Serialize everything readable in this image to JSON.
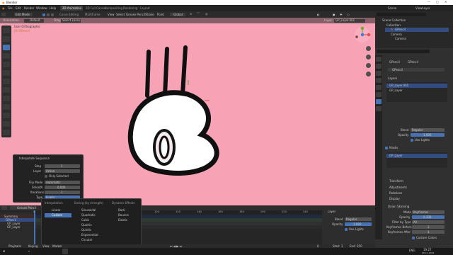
{
  "app": {
    "title": "Blender"
  },
  "menu": {
    "items": [
      "File",
      "Edit",
      "Render",
      "Window",
      "Help"
    ],
    "workspaces": [
      "2D Animation",
      "2D Full Canvas",
      "Compositing",
      "Rendering",
      "Layout"
    ],
    "scene_label": "Scene",
    "view_layer_label": "ViewLayer"
  },
  "header3d": {
    "mode": "Edit Mode",
    "view": "View",
    "select": "Select",
    "gpencil": "Grease Pencil",
    "stroke": "Stroke",
    "point": "Point",
    "orientation": "Global",
    "orient_label": "Orientation:",
    "orient_value": "Default",
    "drag_label": "Drag:",
    "drag_value": "Select Lasso",
    "curve_editing": "Curve Editing",
    "multiframe": "Multiframe",
    "layer_label": "Layer",
    "layer_value": "GP_Layer.001"
  },
  "viewport": {
    "info_line1": "User Orthographic",
    "info_line2": "(0) GPencil",
    "accent": "#f8a2b5"
  },
  "outliner": {
    "title": "Scene Collection",
    "items": [
      "Collection",
      "GPencil",
      "Camera",
      "Camera"
    ]
  },
  "props": {
    "object": "GPencil",
    "data": "GPencil",
    "datablock": "GPencil",
    "layers_header": "Layers",
    "layers": [
      "GP_Layer.001",
      "GP_Layer"
    ],
    "blend_label": "Blend",
    "blend_value": "Regular",
    "opacity_label": "Opacity",
    "opacity_value": "1.000",
    "use_lights": "Use Lights",
    "masks_header": "Masks",
    "mask_item": "GP_Layer",
    "sections": [
      "Transform",
      "Adjustments",
      "Relations",
      "Display"
    ],
    "onion_header": "Onion Skinning",
    "mode_label": "Mode",
    "mode_value": "Keyframes",
    "onion_opacity_label": "Opacity",
    "onion_opacity_value": "0.330",
    "filter_label": "Filter by Type",
    "filter_value": "All",
    "keys_before_label": "Keyframes Before",
    "keys_before_value": "1",
    "keys_after_label": "Keyframes After",
    "keys_after_value": "1",
    "custom_colors": "Custom Colors"
  },
  "lastop": {
    "title": "Interpolate Sequence",
    "step_label": "Step",
    "step_value": "1",
    "layer_label": "Layer",
    "layer_value": "Active",
    "only_selected": "Only Selected",
    "flip_label": "Flip Mode",
    "flip_value": "Automatic",
    "smooth_label": "Smooth",
    "smooth_value": "0.000",
    "iter_label": "Iterations",
    "iter_value": "1",
    "type_label": "Type",
    "type_value": "Linear"
  },
  "interp": {
    "col1_header": "Interpolation",
    "col2_header": "Easing (by strength)",
    "col3_header": "Dynamic Effects",
    "col1": [
      "Linear",
      "Custom"
    ],
    "col2": [
      "Sinusoidal",
      "Quadratic",
      "Cubic",
      "Quartic",
      "Quintic",
      "Exponential",
      "Circular"
    ],
    "col3": [
      "Back",
      "Bounce",
      "Elastic"
    ]
  },
  "timeline": {
    "mode": "Grease Pencil",
    "summary": "Summary",
    "object": "GPencil",
    "layers": [
      "GP_Layer",
      "GP_Layer"
    ],
    "ticks": [
      "0",
      "20",
      "40",
      "60",
      "80",
      "100",
      "120",
      "140",
      "160",
      "180",
      "200",
      "220",
      "240"
    ],
    "current_frame": "0"
  },
  "tllayer": {
    "header": "Layer",
    "blend_label": "Blend",
    "blend_value": "Regular",
    "opacity_label": "Opacity",
    "opacity_value": "1.000",
    "use_lights": "Use Lights"
  },
  "playbar": {
    "playback": "Playback",
    "keying": "Keying",
    "view": "View",
    "marker": "Marker",
    "frame": "0",
    "start_label": "Start",
    "start_value": "1",
    "end_label": "End",
    "end_value": "250"
  },
  "statusbar": {
    "lang": "ENG",
    "time": "19:27",
    "date": "06-11-2022"
  }
}
